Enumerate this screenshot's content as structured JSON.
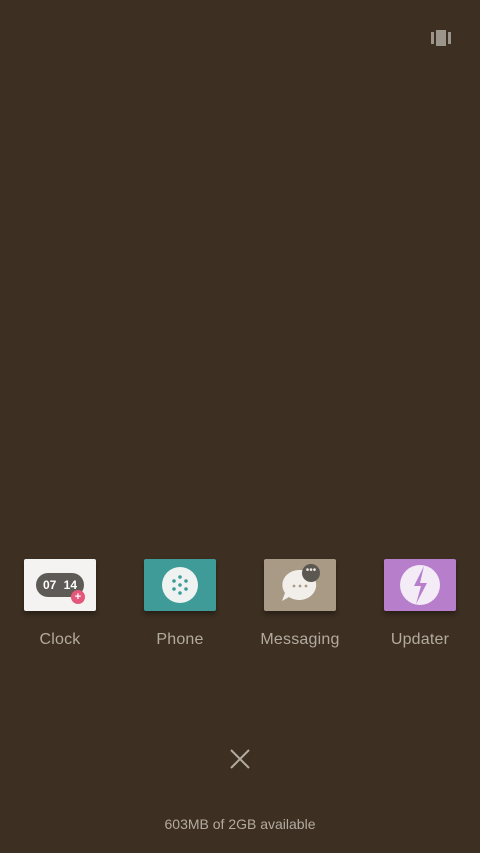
{
  "header": {
    "layout_toggle_icon": "multi-window-icon"
  },
  "recent_apps": [
    {
      "label": "Clock",
      "icon": "clock-icon",
      "color": "#f4f3f1",
      "clock_hours": "07",
      "clock_minutes": "14"
    },
    {
      "label": "Phone",
      "icon": "phone-dialpad-icon",
      "color": "#3f9b97"
    },
    {
      "label": "Messaging",
      "icon": "message-bubble-icon",
      "color": "#a99a86"
    },
    {
      "label": "Updater",
      "icon": "updater-icon",
      "color": "#b67ecb"
    }
  ],
  "footer": {
    "close_icon": "close-icon",
    "memory_text": "603MB of 2GB available"
  },
  "colors": {
    "background": "#3d2f22",
    "label_text": "#b3aba0"
  }
}
